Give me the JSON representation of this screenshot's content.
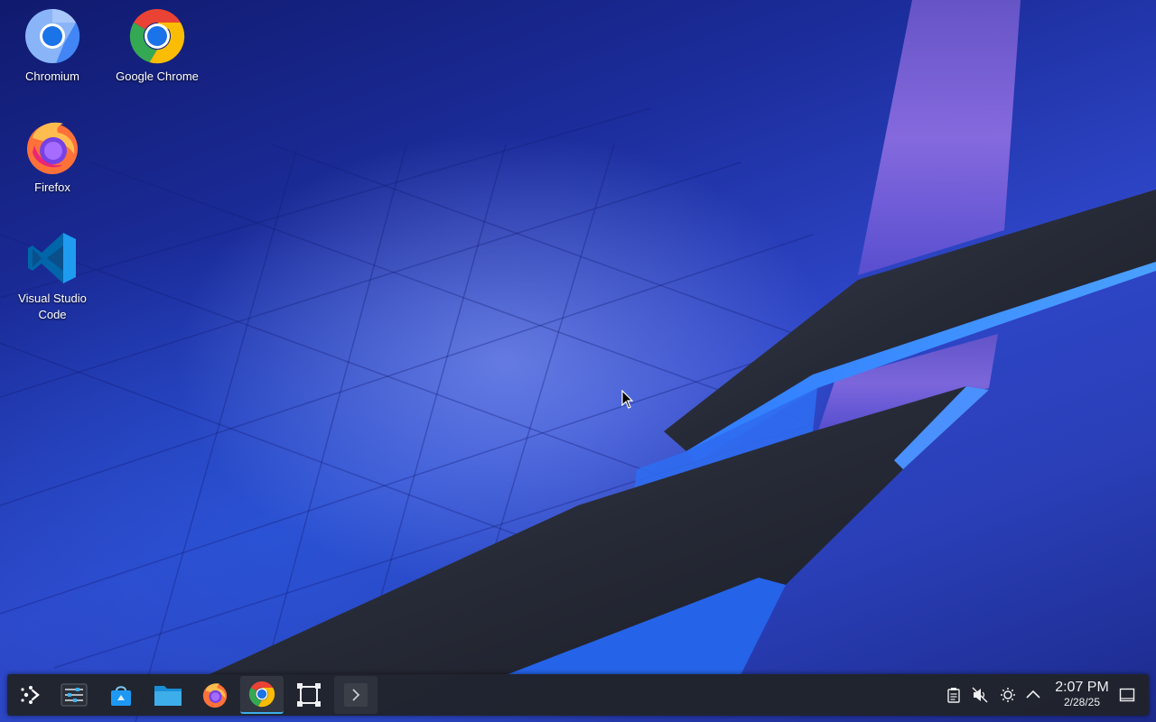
{
  "desktop": {
    "icons": [
      {
        "label": "Chromium"
      },
      {
        "label": "Google Chrome"
      },
      {
        "label": "Firefox"
      },
      {
        "label": "Visual Studio Code"
      }
    ]
  },
  "taskbar": {
    "items": [
      {
        "name": "application-launcher",
        "icon": "steamos-launcher-icon"
      },
      {
        "name": "system-settings",
        "icon": "settings-sliders-icon"
      },
      {
        "name": "discover-store",
        "icon": "store-bag-icon"
      },
      {
        "name": "file-manager",
        "icon": "folder-icon"
      },
      {
        "name": "firefox",
        "icon": "firefox-icon"
      },
      {
        "name": "google-chrome",
        "icon": "chrome-icon",
        "active": true
      },
      {
        "name": "screenshot-tool",
        "icon": "selection-frame-icon"
      },
      {
        "name": "terminal",
        "icon": "terminal-prompt-icon"
      }
    ],
    "tray": {
      "icons": [
        "clipboard-icon",
        "volume-muted-icon",
        "brightness-icon",
        "chevron-up-icon"
      ],
      "clock": {
        "time": "2:07 PM",
        "date": "2/28/25"
      },
      "show_desktop_icon": "show-desktop-icon"
    }
  },
  "colors": {
    "accent": "#3daee9",
    "taskbar_bg": "#20232a",
    "wallpaper_blue": "#2a3fb8",
    "wallpaper_purple": "#8a6ce0"
  }
}
